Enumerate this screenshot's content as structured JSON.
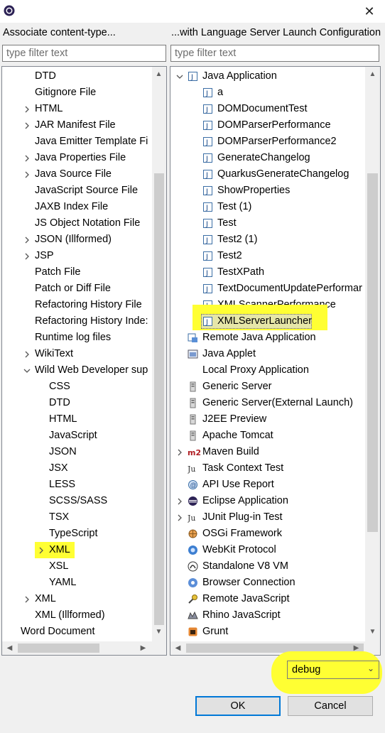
{
  "left": {
    "title": "Associate content-type...",
    "filter_placeholder": "type filter text",
    "items": [
      {
        "label": "DTD",
        "indent": 1,
        "expander": false
      },
      {
        "label": "Gitignore File",
        "indent": 1,
        "expander": false
      },
      {
        "label": "HTML",
        "indent": 1,
        "expander": true
      },
      {
        "label": "JAR Manifest File",
        "indent": 1,
        "expander": true
      },
      {
        "label": "Java Emitter Template Fi",
        "indent": 1,
        "expander": false
      },
      {
        "label": "Java Properties File",
        "indent": 1,
        "expander": true
      },
      {
        "label": "Java Source File",
        "indent": 1,
        "expander": true
      },
      {
        "label": "JavaScript Source File",
        "indent": 1,
        "expander": false
      },
      {
        "label": "JAXB Index File",
        "indent": 1,
        "expander": false
      },
      {
        "label": "JS Object Notation File",
        "indent": 1,
        "expander": false
      },
      {
        "label": "JSON (Illformed)",
        "indent": 1,
        "expander": true
      },
      {
        "label": "JSP",
        "indent": 1,
        "expander": true
      },
      {
        "label": "Patch File",
        "indent": 1,
        "expander": false
      },
      {
        "label": "Patch or Diff File",
        "indent": 1,
        "expander": false
      },
      {
        "label": "Refactoring History File",
        "indent": 1,
        "expander": false
      },
      {
        "label": "Refactoring History Inde:",
        "indent": 1,
        "expander": false
      },
      {
        "label": "Runtime log files",
        "indent": 1,
        "expander": false
      },
      {
        "label": "WikiText",
        "indent": 1,
        "expander": true
      },
      {
        "label": "Wild Web Developer sup",
        "indent": 1,
        "expander": "open"
      },
      {
        "label": "CSS",
        "indent": 2,
        "expander": false
      },
      {
        "label": "DTD",
        "indent": 2,
        "expander": false
      },
      {
        "label": "HTML",
        "indent": 2,
        "expander": false
      },
      {
        "label": "JavaScript",
        "indent": 2,
        "expander": false
      },
      {
        "label": "JSON",
        "indent": 2,
        "expander": false
      },
      {
        "label": "JSX",
        "indent": 2,
        "expander": false
      },
      {
        "label": "LESS",
        "indent": 2,
        "expander": false
      },
      {
        "label": "SCSS/SASS",
        "indent": 2,
        "expander": false
      },
      {
        "label": "TSX",
        "indent": 2,
        "expander": false
      },
      {
        "label": "TypeScript",
        "indent": 2,
        "expander": false
      },
      {
        "label": "XML",
        "indent": 2,
        "expander": true,
        "highlight": true
      },
      {
        "label": "XSL",
        "indent": 2,
        "expander": false
      },
      {
        "label": "YAML",
        "indent": 2,
        "expander": false
      },
      {
        "label": "XML",
        "indent": 1,
        "expander": true
      },
      {
        "label": "XML (Illformed)",
        "indent": 1,
        "expander": false
      },
      {
        "label": "Word Document",
        "indent": 0,
        "expander": false
      }
    ]
  },
  "right": {
    "title": "...with Language Server Launch Configuration",
    "filter_placeholder": "type filter text",
    "items": [
      {
        "label": "Java Application",
        "indent": 0,
        "expander": "open",
        "icon": "java-app-icon"
      },
      {
        "label": "a",
        "indent": 1,
        "icon": "java-launch-icon"
      },
      {
        "label": "DOMDocumentTest",
        "indent": 1,
        "icon": "java-launch-icon"
      },
      {
        "label": "DOMParserPerformance",
        "indent": 1,
        "icon": "java-launch-icon"
      },
      {
        "label": "DOMParserPerformance2",
        "indent": 1,
        "icon": "java-launch-icon"
      },
      {
        "label": "GenerateChangelog",
        "indent": 1,
        "icon": "java-launch-icon"
      },
      {
        "label": "QuarkusGenerateChangelog",
        "indent": 1,
        "icon": "java-launch-icon"
      },
      {
        "label": "ShowProperties",
        "indent": 1,
        "icon": "java-launch-icon"
      },
      {
        "label": "Test (1)",
        "indent": 1,
        "icon": "java-launch-icon"
      },
      {
        "label": "Test",
        "indent": 1,
        "icon": "java-launch-icon"
      },
      {
        "label": "Test2 (1)",
        "indent": 1,
        "icon": "java-launch-icon"
      },
      {
        "label": "Test2",
        "indent": 1,
        "icon": "java-launch-icon"
      },
      {
        "label": "TestXPath",
        "indent": 1,
        "icon": "java-launch-icon"
      },
      {
        "label": "TextDocumentUpdatePerformar",
        "indent": 1,
        "icon": "java-launch-icon"
      },
      {
        "label": "XMLScannerPerformance",
        "indent": 1,
        "icon": "java-launch-icon"
      },
      {
        "label": "XMLServerLauncher",
        "indent": 1,
        "icon": "java-launch-icon",
        "highlight": true,
        "selected": true
      },
      {
        "label": "Remote Java Application",
        "indent": 0,
        "icon": "remote-java-icon"
      },
      {
        "label": "Java Applet",
        "indent": 0,
        "icon": "applet-icon"
      },
      {
        "label": "Local Proxy Application",
        "indent": 0,
        "icon": ""
      },
      {
        "label": "Generic Server",
        "indent": 0,
        "icon": "server-icon"
      },
      {
        "label": "Generic Server(External Launch)",
        "indent": 0,
        "icon": "server-icon"
      },
      {
        "label": "J2EE Preview",
        "indent": 0,
        "icon": "server-icon"
      },
      {
        "label": "Apache Tomcat",
        "indent": 0,
        "icon": "server-icon"
      },
      {
        "label": "Maven Build",
        "indent": 0,
        "expander": true,
        "icon": "maven-icon"
      },
      {
        "label": "Task Context Test",
        "indent": 0,
        "icon": "task-icon"
      },
      {
        "label": "API Use Report",
        "indent": 0,
        "icon": "api-icon"
      },
      {
        "label": "Eclipse Application",
        "indent": 0,
        "expander": true,
        "icon": "eclipse-icon"
      },
      {
        "label": "JUnit Plug-in Test",
        "indent": 0,
        "expander": true,
        "icon": "junit-icon"
      },
      {
        "label": "OSGi Framework",
        "indent": 0,
        "icon": "osgi-icon"
      },
      {
        "label": "WebKit Protocol",
        "indent": 0,
        "icon": "webkit-icon"
      },
      {
        "label": "Standalone V8 VM",
        "indent": 0,
        "icon": "v8-icon"
      },
      {
        "label": "Browser Connection",
        "indent": 0,
        "icon": "browser-icon"
      },
      {
        "label": "Remote JavaScript",
        "indent": 0,
        "icon": "remote-js-icon"
      },
      {
        "label": "Rhino JavaScript",
        "indent": 0,
        "icon": "rhino-icon"
      },
      {
        "label": "Grunt",
        "indent": 0,
        "icon": "grunt-icon"
      }
    ]
  },
  "mode_select": {
    "value": "debug"
  },
  "buttons": {
    "ok": "OK",
    "cancel": "Cancel"
  },
  "colors": {
    "highlight": "#ffff33",
    "selection": "#cce8ff",
    "accent": "#0078d7"
  }
}
